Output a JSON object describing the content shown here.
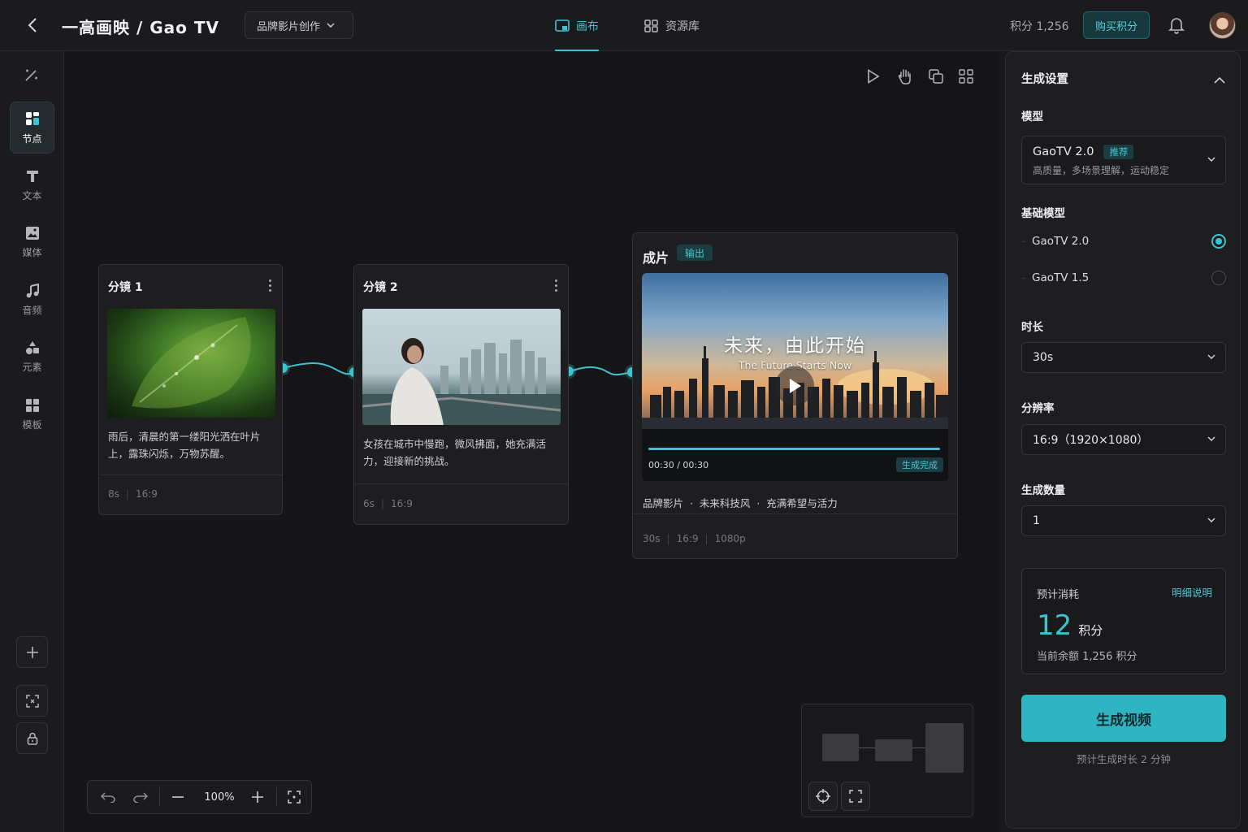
{
  "header": {
    "brand": "一高画映 / Gao TV",
    "project": "品牌影片创作",
    "tabs": [
      {
        "label": "画布",
        "active": true
      },
      {
        "label": "资源库",
        "active": false
      }
    ],
    "credits": "积分 1,256",
    "buy_label": "购买积分"
  },
  "sidebar": {
    "items": [
      {
        "label": "节点",
        "icon": "nodes-icon",
        "active": true
      },
      {
        "label": "文本",
        "icon": "text-icon"
      },
      {
        "label": "媒体",
        "icon": "image-icon"
      },
      {
        "label": "音频",
        "icon": "music-icon"
      },
      {
        "label": "元素",
        "icon": "shapes-icon"
      },
      {
        "label": "模板",
        "icon": "template-icon"
      }
    ]
  },
  "canvas": {
    "zoom": "100%",
    "cards": [
      {
        "title": "分镜 1",
        "desc": "雨后，清晨的第一缕阳光洒在叶片上，露珠闪烁，万物苏醒。",
        "duration": "8s",
        "ratio": "16:9"
      },
      {
        "title": "分镜 2",
        "desc": "女孩在城市中慢跑，微风拂面，她充满活力，迎接新的挑战。",
        "duration": "6s",
        "ratio": "16:9"
      }
    ],
    "output": {
      "title": "成片",
      "tag": "输出",
      "video_title": "未来，由此开始",
      "video_subtitle": "The Future Starts Now",
      "time": "00:30 / 00:30",
      "progress": 1.0,
      "status": "生成完成",
      "tags": "品牌影片  ·  未来科技风  ·  充满希望与活力",
      "duration": "30s",
      "ratio": "16:9",
      "resolution": "1080p"
    }
  },
  "settings": {
    "title": "生成设置",
    "model_label": "模型",
    "model_name": "GaoTV 2.0",
    "model_badge": "推荐",
    "model_desc": "高质量，多场景理解，运动稳定",
    "base_label": "基础模型",
    "base_options": [
      {
        "label": "GaoTV 2.0",
        "selected": true
      },
      {
        "label": "GaoTV 1.5",
        "selected": false
      }
    ],
    "duration_label": "时长",
    "duration_value": "30s",
    "resolution_label": "分辨率",
    "resolution_value": "16:9（1920×1080）",
    "count_label": "生成数量",
    "count_value": "1",
    "cost_label": "预计消耗",
    "cost_detail": "明细说明",
    "cost_value": "12",
    "cost_unit": "积分",
    "balance": "当前余额 1,256 积分",
    "generate_label": "生成视频",
    "eta": "预计生成时长 2 分钟"
  },
  "colors": {
    "accent": "#3cc3cf",
    "background": "#151517",
    "panel": "#1e1e21"
  }
}
